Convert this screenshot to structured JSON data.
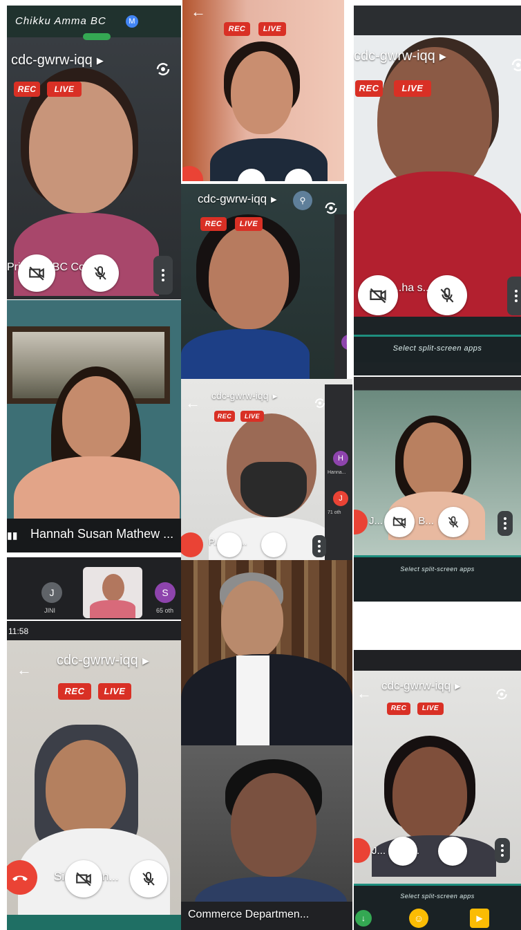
{
  "colors": {
    "rec": "#d93025",
    "hangup": "#ea4335",
    "panel_dark": "#202124",
    "accent_teal": "#1e8e7e"
  },
  "header": {
    "contact_name": "Chikku Amma BC",
    "contact_badge": "M"
  },
  "tiles": {
    "t1": {
      "meet_code": "cdc-gwrw-iqq",
      "rec": "REC",
      "live": "LIVE",
      "name": "Principal BC Coll..."
    },
    "t2": {
      "rec": "REC",
      "live": "LIVE"
    },
    "t3": {
      "meet_code": "cdc-gwrw-iqq",
      "rec": "REC",
      "live": "LIVE",
      "name": "...ha s..."
    },
    "t4": {
      "meet_code": "cdc-gwrw-iqq",
      "rec": "REC",
      "live": "LIVE"
    },
    "t5": {
      "name": "Hannah Susan Mathew ..."
    },
    "t6": {
      "meet_code": "cdc-gwrw-iqq",
      "rec": "REC",
      "live": "LIVE",
      "name": "P...n Ph..."
    },
    "t7": {
      "name": "J... Varg... B..."
    },
    "t8": {
      "status_time": "11:58",
      "meet_code": "cdc-gwrw-iqq",
      "rec": "REC",
      "live": "LIVE",
      "name": "Si... Karun..."
    },
    "t9": {
      "meet_code": "cdc-gwrw-iqq",
      "rec": "REC",
      "live": "LIVE",
      "name": "J... COB..."
    },
    "t10": {
      "name": "Commerce Departmen..."
    }
  },
  "participants_strip": [
    {
      "letter": "J",
      "label": "JINI"
    },
    {
      "letter": "",
      "label": ""
    },
    {
      "letter": "S",
      "label": "65 oth"
    }
  ],
  "side_avatars": [
    {
      "letter": "H",
      "label": "Hanna..."
    },
    {
      "letter": "J",
      "label": "71 oth"
    }
  ],
  "split_screen_label": "Select split-screen apps"
}
